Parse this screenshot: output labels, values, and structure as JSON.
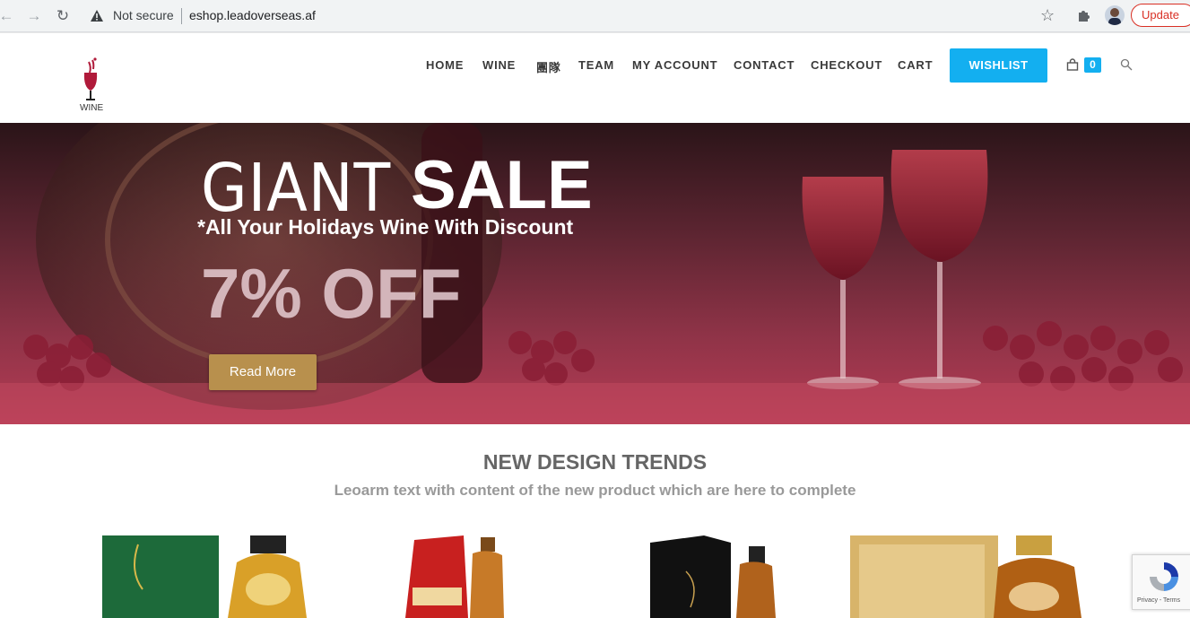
{
  "browser": {
    "security_label": "Not secure",
    "url": "eshop.leadoverseas.af",
    "update_label": "Update"
  },
  "header": {
    "logo_text": "WINE",
    "menu": [
      {
        "label": "HOME"
      },
      {
        "label": "WINE"
      },
      {
        "label": "團隊"
      },
      {
        "label": "TEAM"
      },
      {
        "label": "MY ACCOUNT"
      },
      {
        "label": "CONTACT"
      },
      {
        "label": "CHECKOUT"
      },
      {
        "label": "CART"
      }
    ],
    "wishlist_label": "WISHLIST",
    "cart_count": "0"
  },
  "hero": {
    "title_light": "GIANT",
    "title_bold": "SALE",
    "subtitle": "*All Your Holidays Wine With Discount",
    "discount": "7% OFF",
    "button_label": "Read More"
  },
  "section": {
    "title": "NEW DESIGN TRENDS",
    "subtitle": "Leoarm text with content of the new product which are here to complete"
  },
  "recaptcha": {
    "links": "Privacy - Terms"
  },
  "colors": {
    "accent": "#13aff0",
    "button_gold": "#b8904d",
    "update_red": "#d93025"
  }
}
